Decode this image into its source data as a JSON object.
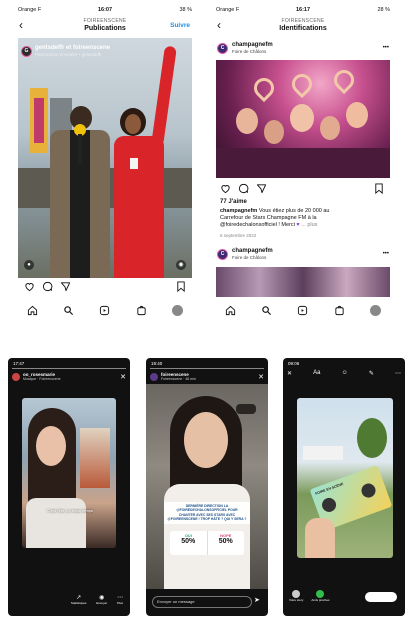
{
  "phone1": {
    "status": {
      "carrier": "Orange F",
      "time": "16:07",
      "battery": "38 %"
    },
    "nav": {
      "back": "‹",
      "subtitle": "FOIREENSCENE",
      "title": "Publications",
      "action": "Suivre"
    },
    "post_header": {
      "name": "gentsdeffr et foireenscene",
      "sub": "Partenariat rémunéré • gentsdeffr"
    },
    "icons": [
      "heart-icon",
      "comment-icon",
      "share-icon",
      "bookmark-icon"
    ]
  },
  "phone2": {
    "status": {
      "carrier": "Orange F",
      "time": "16:17",
      "battery": "28 %"
    },
    "nav": {
      "back": "‹",
      "subtitle": "FOIREENSCENE",
      "title": "Identifications"
    },
    "post_header": {
      "name": "champagnefm",
      "sub": "Foire de Châlons",
      "more": "•••"
    },
    "likes": "77 J'aime",
    "caption_user": "champagnefm",
    "caption_line1": " Vous étiez plus de 20 000 au",
    "caption_line2": "Carrefour de Stars Champagne FM à la",
    "caption_line3": "@foiredechalonsofficiel ! Merci",
    "caption_more": "... plus",
    "date": "6 septembre 2022",
    "next_header": {
      "name": "champagnefm",
      "sub": "Foire de Châlons",
      "more": "•••"
    }
  },
  "story1": {
    "status": {
      "time": "17:47"
    },
    "user": "oo_rosesmarie",
    "sub": "Musique · Foireenscene",
    "caption": "C'est l'été, Le beau temps",
    "labels": [
      "Statistiques",
      "Envoyer",
      "Plus"
    ]
  },
  "story2": {
    "status": {
      "time": "19:40"
    },
    "user": "foireenscene",
    "sub": "Foireenscene · 46 min",
    "banner_l1": "DERNIÈRE DIRECTION LA",
    "banner_l2": "@FOIREDECHALONSOFFICIEL POUR",
    "banner_l3": "CHANTER AVEC SES STARS AVEC",
    "banner_l4": "@FOIREENSCENE ! TROP HÂTE ? QUI Y SERA ?",
    "poll": [
      {
        "label": "OUI",
        "value": "50%"
      },
      {
        "label": "NOPE",
        "value": "50%"
      }
    ],
    "poll_fill": 0.5,
    "message_placeholder": "Envoyer un message"
  },
  "story3": {
    "status": {
      "time": "09:06"
    },
    "ticket_text": "FOIRE EN SCÈNE",
    "labels": [
      "Votre story",
      "Amis proches"
    ],
    "button": "Envoyer à"
  }
}
